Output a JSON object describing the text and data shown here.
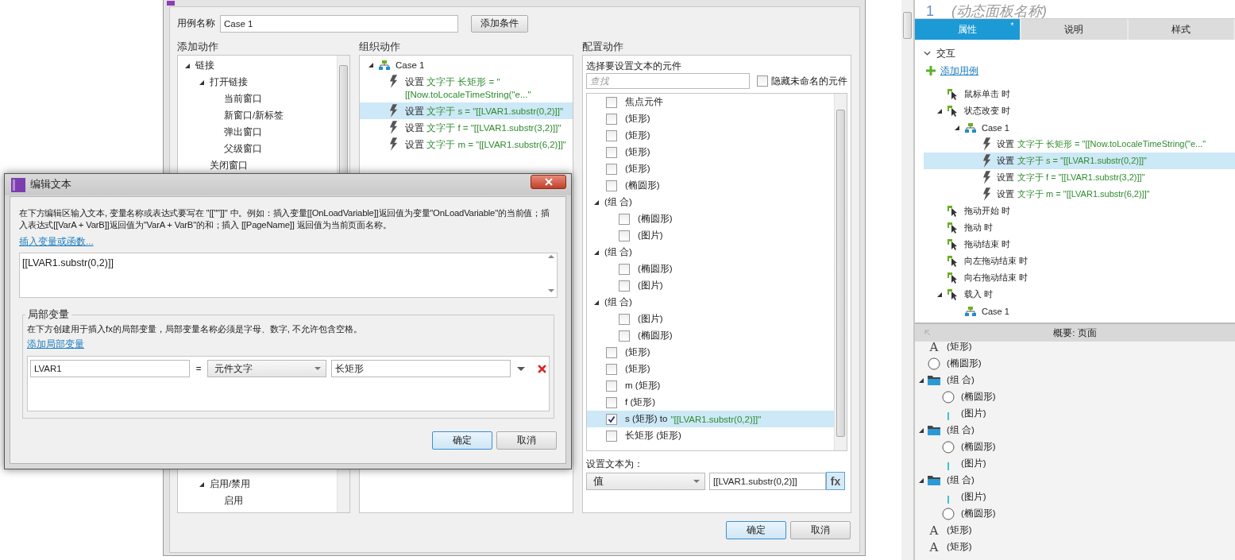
{
  "case_editor": {
    "case_name_label": "用例名称",
    "case_name": "Case 1",
    "add_condition_button": "添加条件",
    "add_actions": {
      "title": "添加动作",
      "top_items": [
        {
          "label": "链接",
          "expanded": true,
          "children": [
            {
              "label": "打开链接",
              "expanded": true,
              "children": [
                {
                  "label": "当前窗口"
                },
                {
                  "label": "新窗口/新标签"
                },
                {
                  "label": "弹出窗口"
                },
                {
                  "label": "父级窗口"
                }
              ]
            },
            {
              "label": "关闭窗口"
            }
          ]
        }
      ],
      "bottom_items": [
        {
          "label": "启用/禁用",
          "expanded": true,
          "children": [
            {
              "label": "启用"
            }
          ]
        }
      ]
    },
    "organize_actions": {
      "title": "组织动作",
      "case": {
        "label": "Case 1",
        "expanded": true
      },
      "actions": [
        {
          "verb": "设置",
          "detail": "文字于 长矩形 = \"[[Now.toLocaleTimeString(\"e...\"",
          "selected": false
        },
        {
          "verb": "设置",
          "detail": "文字于 s = \"[[LVAR1.substr(0,2)]]\"",
          "selected": true
        },
        {
          "verb": "设置",
          "detail": "文字于 f = \"[[LVAR1.substr(3,2)]]\"",
          "selected": false
        },
        {
          "verb": "设置",
          "detail": "文字于 m = \"[[LVAR1.substr(6,2)]]\"",
          "selected": false
        }
      ]
    },
    "configure": {
      "title": "配置动作",
      "select_label": "选择要设置文本的元件",
      "search_placeholder": "查找",
      "hide_unnamed": {
        "label": "隐藏未命名的元件",
        "checked": false
      },
      "widgets": [
        {
          "kind": "widget",
          "label": "焦点元件",
          "checked": false,
          "selected": false
        },
        {
          "kind": "widget",
          "label": "(矩形)",
          "checked": false,
          "selected": false
        },
        {
          "kind": "widget",
          "label": "(矩形)",
          "checked": false,
          "selected": false
        },
        {
          "kind": "widget",
          "label": "(矩形)",
          "checked": false,
          "selected": false
        },
        {
          "kind": "widget",
          "label": "(矩形)",
          "checked": false,
          "selected": false
        },
        {
          "kind": "widget",
          "label": "(椭圆形)",
          "checked": false,
          "selected": false
        },
        {
          "kind": "group",
          "label": "(组 合)",
          "expanded": true,
          "selected": false,
          "children": [
            {
              "kind": "widget",
              "label": "(椭圆形)",
              "checked": false,
              "selected": false
            },
            {
              "kind": "widget",
              "label": "(图片)",
              "checked": false,
              "selected": false
            }
          ]
        },
        {
          "kind": "group",
          "label": "(组 合)",
          "expanded": true,
          "selected": false,
          "children": [
            {
              "kind": "widget",
              "label": "(椭圆形)",
              "checked": false,
              "selected": false
            },
            {
              "kind": "widget",
              "label": "(图片)",
              "checked": false,
              "selected": false
            }
          ]
        },
        {
          "kind": "group",
          "label": "(组 合)",
          "expanded": true,
          "selected": false,
          "children": [
            {
              "kind": "widget",
              "label": "(图片)",
              "checked": false,
              "selected": false
            },
            {
              "kind": "widget",
              "label": "(椭圆形)",
              "checked": false,
              "selected": false
            }
          ]
        },
        {
          "kind": "widget",
          "label": "(矩形)",
          "checked": false,
          "selected": false
        },
        {
          "kind": "widget",
          "label": "(矩形)",
          "checked": false,
          "selected": false
        },
        {
          "kind": "widget",
          "label": "m (矩形)",
          "checked": false,
          "selected": false
        },
        {
          "kind": "widget",
          "label": "f (矩形)",
          "checked": false,
          "selected": false
        },
        {
          "kind": "widget",
          "label": "s (矩形) to",
          "assignment": "\"[[LVAR1.substr(0,2)]]\"",
          "checked": true,
          "selected": true
        },
        {
          "kind": "widget",
          "label": "长矩形 (矩形)",
          "checked": false,
          "selected": false
        }
      ],
      "set_text_label": "设置文本为：",
      "value_type": "值",
      "value": "[[LVAR1.substr(0,2)]]",
      "fx_button": "fx"
    },
    "ok_button": "确定",
    "cancel_button": "取消"
  },
  "edit_text_dialog": {
    "title": "编辑文本",
    "description": "在下方编辑区输入文本, 变量名称或表达式要写在 \"[[\"\"]]\" 中。例如：插入变量[[OnLoadVariable]]返回值为变量\"OnLoadVariable\"的当前值；插入表达式[[VarA + VarB]]返回值为\"VarA + VarB\"的和；插入 [[PageName]] 返回值为当前页面名称。",
    "insert_link": "插入变量或函数...",
    "text_value": "[[LVAR1.substr(0,2)]]",
    "local_variables": {
      "legend": "局部变量",
      "description": "在下方创建用于插入fx的局部变量，局部变量名称必须是字母、数字, 不允许包含空格。",
      "add_link": "添加局部变量",
      "rows": [
        {
          "name": "LVAR1",
          "equals": "=",
          "type": "元件文字",
          "target": "长矩形"
        }
      ]
    },
    "ok_button": "确定",
    "cancel_button": "取消"
  },
  "inspector": {
    "number": "1",
    "title": "(动态面板名称)",
    "tabs": [
      {
        "label": "属性",
        "marker": "*",
        "selected": true
      },
      {
        "label": "说明",
        "selected": false
      },
      {
        "label": "样式",
        "selected": false
      }
    ],
    "section": {
      "label": "交互",
      "expanded": true
    },
    "add_case_link": "添加用例",
    "events": [
      {
        "kind": "event",
        "label": "鼠标单击 时",
        "selected": false
      },
      {
        "kind": "event",
        "label": "状态改变 时",
        "expanded": true,
        "selected": false,
        "children": [
          {
            "kind": "case",
            "label": "Case 1",
            "expanded": true,
            "selected": false,
            "children": [
              {
                "kind": "action",
                "verb": "设置",
                "detail": "文字于 长矩形 = \"[[Now.toLocaleTimeString(\"e...\"",
                "selected": false
              },
              {
                "kind": "action",
                "verb": "设置",
                "detail": "文字于 s = \"[[LVAR1.substr(0,2)]]\"",
                "selected": true
              },
              {
                "kind": "action",
                "verb": "设置",
                "detail": "文字于 f = \"[[LVAR1.substr(3,2)]]\"",
                "selected": false
              },
              {
                "kind": "action",
                "verb": "设置",
                "detail": "文字于 m = \"[[LVAR1.substr(6,2)]]\"",
                "selected": false
              }
            ]
          }
        ]
      },
      {
        "kind": "event",
        "label": "拖动开始 时",
        "selected": false
      },
      {
        "kind": "event",
        "label": "拖动 时",
        "selected": false
      },
      {
        "kind": "event",
        "label": "拖动结束 时",
        "selected": false
      },
      {
        "kind": "event",
        "label": "向左拖动结束 时",
        "selected": false
      },
      {
        "kind": "event",
        "label": "向右拖动结束 时",
        "selected": false
      },
      {
        "kind": "event",
        "label": "载入 时",
        "expanded": true,
        "selected": false,
        "children": [
          {
            "kind": "case",
            "label": "Case 1",
            "selected": false
          }
        ]
      }
    ],
    "outline": {
      "title": "概要: 页面",
      "items": [
        {
          "kind": "text",
          "icon": "A",
          "label": "(矩形)"
        },
        {
          "kind": "ellipse",
          "label": "(椭圆形)"
        },
        {
          "kind": "group",
          "label": "(组 合)",
          "expanded": true,
          "children": [
            {
              "kind": "ellipse",
              "label": "(椭圆形)"
            },
            {
              "kind": "image",
              "label": "(图片)"
            }
          ]
        },
        {
          "kind": "group",
          "label": "(组 合)",
          "expanded": true,
          "children": [
            {
              "kind": "ellipse",
              "label": "(椭圆形)"
            },
            {
              "kind": "image",
              "label": "(图片)"
            }
          ]
        },
        {
          "kind": "group",
          "label": "(组 合)",
          "expanded": true,
          "children": [
            {
              "kind": "image",
              "label": "(图片)"
            },
            {
              "kind": "ellipse",
              "label": "(椭圆形)"
            }
          ]
        },
        {
          "kind": "text",
          "icon": "A",
          "label": "(矩形)"
        },
        {
          "kind": "text",
          "icon": "A",
          "label": "(矩形)"
        }
      ]
    }
  }
}
